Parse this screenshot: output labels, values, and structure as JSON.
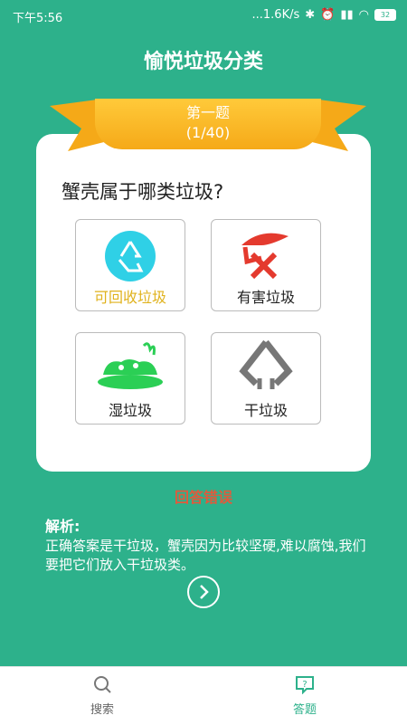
{
  "status": {
    "time": "下午5:56",
    "speed": "...1.6K/s",
    "battery": "32"
  },
  "header": {
    "title": "愉悦垃圾分类"
  },
  "ribbon": {
    "line1": "第一题",
    "line2": "(1/40)"
  },
  "question": "蟹壳属于哪类垃圾?",
  "options": [
    {
      "label": "可回收垃圾",
      "icon": "recycle-icon"
    },
    {
      "label": "有害垃圾",
      "icon": "hazardous-icon"
    },
    {
      "label": "湿垃圾",
      "icon": "wet-waste-icon"
    },
    {
      "label": "干垃圾",
      "icon": "dry-waste-icon"
    }
  ],
  "result": "回答错误",
  "analysis": {
    "heading": "解析:",
    "text": "正确答案是干垃圾，蟹壳因为比较坚硬,难以腐蚀,我们要把它们放入干垃圾类。"
  },
  "tabs": [
    {
      "label": "搜索",
      "icon": "search-icon"
    },
    {
      "label": "答题",
      "icon": "quiz-icon"
    }
  ],
  "colors": {
    "teal": "#2db18b",
    "accent": "#e05a3c",
    "gold": "#f5b21c"
  }
}
